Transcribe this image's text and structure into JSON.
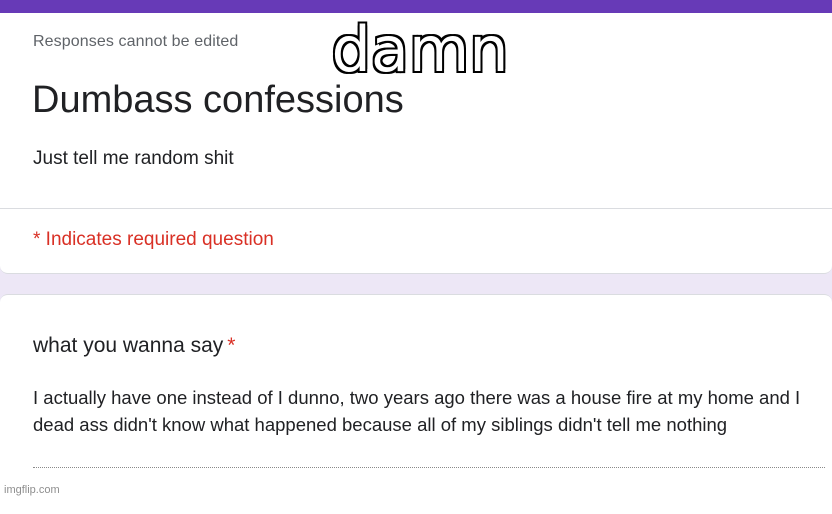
{
  "form": {
    "accent_color": "#673ab7",
    "responses_note": "Responses cannot be edited",
    "title": "Dumbass confessions",
    "description": "Just tell me random shit",
    "required_note": "* Indicates required question"
  },
  "question": {
    "title": "what you wanna say",
    "required_marker": "*",
    "answer": "I actually have one instead of I dunno, two years ago there was a house fire at my home and I dead ass didn't know what happened because all of my siblings didn't tell me nothing"
  },
  "meme": {
    "caption": "damn",
    "watermark": "imgflip.com"
  }
}
